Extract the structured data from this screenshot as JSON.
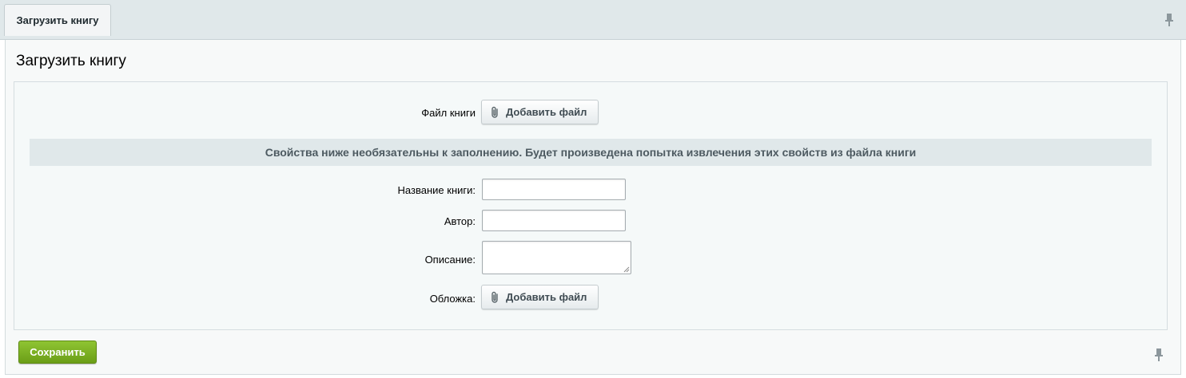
{
  "tabs": [
    {
      "label": "Загрузить книгу"
    }
  ],
  "page_title": "Загрузить книгу",
  "form": {
    "book_file": {
      "label": "Файл книги",
      "button_label": "Добавить файл"
    },
    "info_text": "Свойства ниже необязательны к заполнению. Будет произведена попытка извлечения этих свойств из файла книги",
    "book_title": {
      "label": "Название книги:",
      "value": ""
    },
    "author": {
      "label": "Автор:",
      "value": ""
    },
    "description": {
      "label": "Описание:",
      "value": ""
    },
    "cover": {
      "label": "Обложка:",
      "button_label": "Добавить файл"
    }
  },
  "save_label": "Сохранить",
  "icons": {
    "pin": "pin-icon",
    "attach": "paperclip-icon"
  },
  "colors": {
    "save_button": "#7bb224",
    "info_bar": "#e0e8ea",
    "tabbar": "#e0e8ea"
  }
}
